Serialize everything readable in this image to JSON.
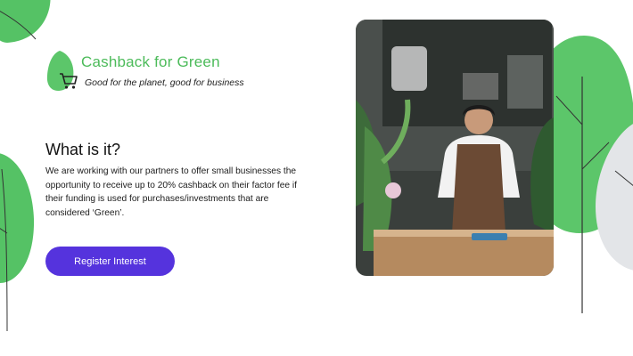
{
  "brand": {
    "title": "Cashback for Green",
    "tagline": "Good for the planet, good for business",
    "icon": "shopping-cart-icon"
  },
  "content": {
    "heading": "What is it?",
    "body": "We are working with our partners to offer small businesses the opportunity to receive up to 20% cashback on their factor fee if their funding is used for purchases/investments that are considered ‘Green’.",
    "cta_label": "Register Interest"
  },
  "photo": {
    "description": "shopkeeper-with-plants"
  },
  "colors": {
    "brand_green": "#4cbb5a",
    "cta_purple": "#5533dd",
    "leaf_grey": "#e3e5e8"
  }
}
